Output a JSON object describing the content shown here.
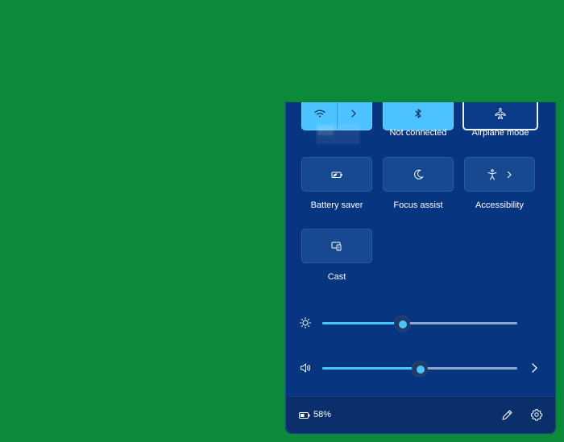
{
  "quick_settings": {
    "tiles": [
      {
        "name": "wifi",
        "label": "",
        "state": "active",
        "split": true
      },
      {
        "name": "bluetooth",
        "label": "Not connected",
        "state": "active"
      },
      {
        "name": "airplane-mode",
        "label": "Airplane mode",
        "state": "outline"
      },
      {
        "name": "battery-saver",
        "label": "Battery saver",
        "state": "inactive"
      },
      {
        "name": "focus-assist",
        "label": "Focus assist",
        "state": "inactive"
      },
      {
        "name": "accessibility",
        "label": "Accessibility",
        "state": "inactive"
      },
      {
        "name": "cast",
        "label": "Cast",
        "state": "inactive"
      }
    ],
    "sliders": {
      "brightness": {
        "value": 0.41,
        "icon": "sun-icon"
      },
      "volume": {
        "value": 0.5,
        "icon": "speaker-icon"
      }
    },
    "footer": {
      "battery_percent": "58%",
      "icons": [
        "battery-icon",
        "pencil-icon",
        "gear-icon"
      ]
    }
  },
  "colors": {
    "background": "#0b8a3a",
    "panel": "#07357f",
    "accent": "#4cc2ff",
    "tile_inactive": "#16498f"
  }
}
